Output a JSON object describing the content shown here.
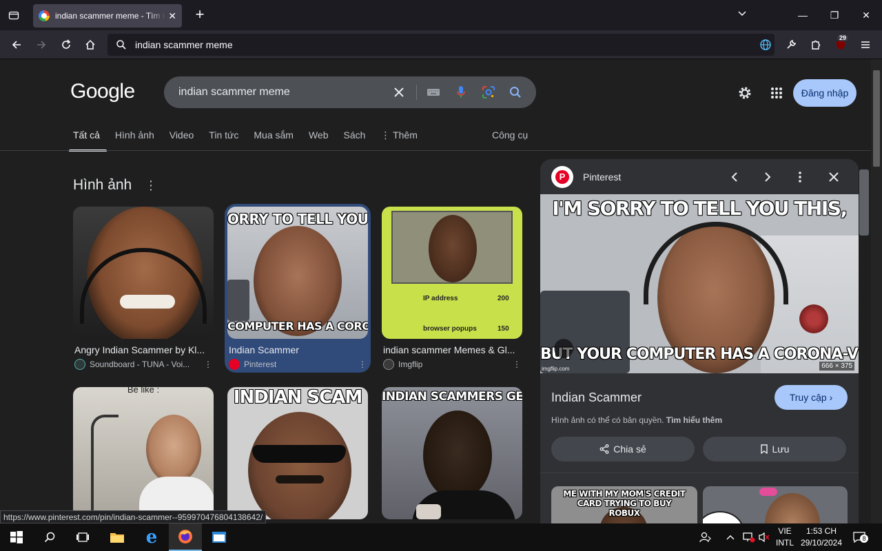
{
  "browser": {
    "tab_title": "indian scammer meme - Tìm trên Google",
    "url_text": "indian scammer meme",
    "extension_badge": "29",
    "status_url": "https://www.pinterest.com/pin/indian-scammer--959970476804138642/"
  },
  "google": {
    "logo": "Google",
    "query": "indian scammer meme",
    "login_label": "Đăng nhập",
    "filters": [
      "Tất cả",
      "Hình ảnh",
      "Video",
      "Tin tức",
      "Mua sắm",
      "Web",
      "Sách",
      "Thêm"
    ],
    "tools_label": "Công cụ",
    "section_title": "Hình ảnh"
  },
  "results": [
    {
      "title": "Angry Indian Scammer by Kl...",
      "source": "Soundboard - TUNA - Voi..."
    },
    {
      "title": "Indian Scammer",
      "source": "Pinterest",
      "selected": true
    },
    {
      "title": "indian scammer Memes & Gl...",
      "source": "Imgflip"
    },
    {
      "caption": "Be like :"
    },
    {
      "caption": "INDIAN SCAM"
    },
    {
      "caption": "INDIAN SCAMMERS GETTIN"
    }
  ],
  "thumb_texts": {
    "r2_top": "ORRY TO TELL YOU TH",
    "r2_bottom": "COMPUTER HAS A CORONA-V",
    "r3_label1": "IP address",
    "r3_val1": "200",
    "r3_label2": "browser popups",
    "r3_val2": "150"
  },
  "panel": {
    "source": "Pinterest",
    "meme_top": "I'M SORRY TO TELL YOU THIS,",
    "meme_bottom": "BUT YOUR COMPUTER HAS A CORONA-VIRUS",
    "watermark": "imgflip.com",
    "dimensions": "666 × 375",
    "title": "Indian Scammer",
    "visit_label": "Truy cập",
    "copyright_text": "Hình ảnh có thể có bản quyền.",
    "learn_more": "Tìm hiểu thêm",
    "share_label": "Chia sẻ",
    "save_label": "Lưu",
    "related_caption": "ME WITH MY MOM'S CREDIT CARD TRYING TO BUY ROBUX"
  },
  "taskbar": {
    "lang_top": "VIE",
    "lang_bottom": "INTL",
    "time": "1:53 CH",
    "date": "29/10/2024",
    "notif_count": "8"
  }
}
